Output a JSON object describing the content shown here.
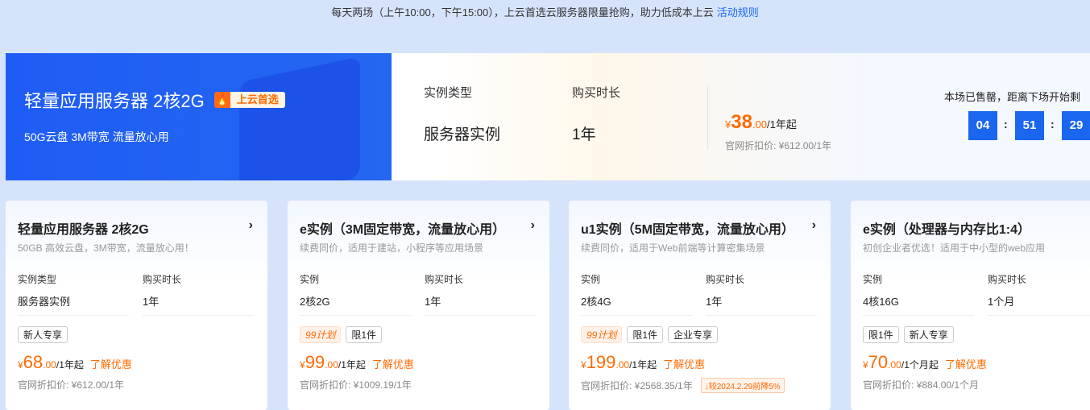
{
  "topbar": {
    "text": "每天两场（上午10:00，下午15:00），上云首选云服务器限量抢购，助力低成本上云",
    "link": "活动规则"
  },
  "hero": {
    "title": "轻量应用服务器 2核2G",
    "badge": "上云首选",
    "subtitle": "50G云盘 3M带宽 流量放心用",
    "type_label": "实例类型",
    "type_value": "服务器实例",
    "dur_label": "购买时长",
    "dur_value": "1年",
    "price_sym": "¥",
    "price_int": "38",
    "price_dec": ".00",
    "price_unit": "/1年起",
    "orig": "官网折扣价: ¥612.00/1年",
    "sold": "本场已售罄，距离下场开始剩",
    "h": "04",
    "m": "51",
    "s": "29"
  },
  "cards": [
    {
      "title": "轻量应用服务器 2核2G",
      "desc": "50GB 高效云盘，3M带宽，流量放心用！",
      "l1": "实例类型",
      "v1": "服务器实例",
      "l2": "购买时长",
      "v2": "1年",
      "tags": [
        "新人专享"
      ],
      "p99": false,
      "price_int": "68",
      "price_dec": ".00",
      "unit": "/1年起",
      "link": "了解优惠",
      "orig": "官网折扣价: ¥612.00/1年"
    },
    {
      "title": "e实例（3M固定带宽，流量放心用）",
      "desc": "续费同价，适用于建站，小程序等应用场景",
      "l1": "实例",
      "v1": "2核2G",
      "l2": "购买时长",
      "v2": "1年",
      "tags": [
        "99计划",
        "限1件"
      ],
      "p99": true,
      "price_int": "99",
      "price_dec": ".00",
      "unit": "/1年起",
      "link": "了解优惠",
      "orig": "官网折扣价: ¥1009.19/1年"
    },
    {
      "title": "u1实例（5M固定带宽，流量放心用）",
      "desc": "续费同价，适用于Web前端等计算密集场景",
      "l1": "实例",
      "v1": "2核4G",
      "l2": "购买时长",
      "v2": "1年",
      "tags": [
        "99计划",
        "限1件",
        "企业专享"
      ],
      "p99": true,
      "price_int": "199",
      "price_dec": ".00",
      "unit": "/1年起",
      "link": "了解优惠",
      "orig": "官网折扣价: ¥2568.35/1年",
      "drop": "较2024.2.29前降5%"
    },
    {
      "title": "e实例（处理器与内存比1:4）",
      "desc": "初创企业者优选！适用于中小型的web应用",
      "l1": "实例",
      "v1": "4核16G",
      "l2": "购买时长",
      "v2": "1个月",
      "tags": [
        "限1件",
        "新人专享"
      ],
      "p99": false,
      "price_int": "70",
      "price_dec": ".00",
      "unit": "/1个月起",
      "link": "了解优惠",
      "orig": "官网折扣价: ¥884.00/1个月"
    }
  ],
  "colors": {
    "accent": "#1a66ef",
    "price": "#ff6a00"
  }
}
